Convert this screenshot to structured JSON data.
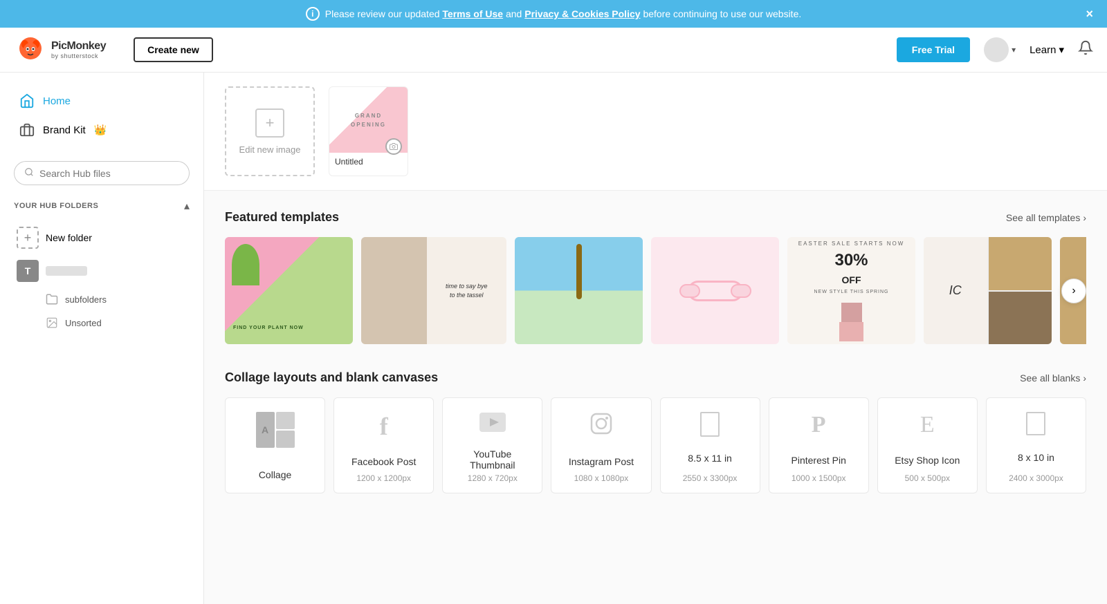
{
  "banner": {
    "text_before": "Please review our updated ",
    "terms_link": "Terms of Use",
    "text_middle": " and ",
    "privacy_link": "Privacy & Cookies Policy",
    "text_after": " before continuing to use our website.",
    "close_label": "×",
    "info_label": "i"
  },
  "header": {
    "logo_name": "PicMonkey",
    "logo_sub": "by shutterstock",
    "create_new_label": "Create new",
    "free_trial_label": "Free Trial",
    "learn_label": "Learn",
    "bell_label": "🔔"
  },
  "sidebar": {
    "nav_items": [
      {
        "id": "home",
        "label": "Home",
        "icon": "home"
      },
      {
        "id": "brand-kit",
        "label": "Brand Kit",
        "icon": "briefcase",
        "badge": "👑"
      }
    ],
    "search_placeholder": "Search Hub files",
    "hub_folders_title": "YOUR HUB FOLDERS",
    "folders": [
      {
        "id": "new-folder",
        "label": "New folder",
        "type": "new"
      },
      {
        "id": "t-folder",
        "label": "T",
        "type": "avatar"
      },
      {
        "id": "unsorted",
        "label": "Unsorted",
        "type": "unsorted"
      }
    ],
    "subfolder_label": "subfolders"
  },
  "recent": {
    "edit_new_label": "Edit new image",
    "files": [
      {
        "id": "untitled",
        "label": "Untitled",
        "type": "grand-opening"
      }
    ]
  },
  "featured_templates": {
    "title": "Featured templates",
    "see_all_label": "See all templates",
    "see_all_arrow": "›",
    "templates": [
      {
        "id": "tpl-1",
        "style": "plant"
      },
      {
        "id": "tpl-2",
        "style": "woman"
      },
      {
        "id": "tpl-3",
        "style": "palm"
      },
      {
        "id": "tpl-4",
        "style": "sunglasses"
      },
      {
        "id": "tpl-5",
        "style": "sale"
      },
      {
        "id": "tpl-6",
        "style": "fashion"
      },
      {
        "id": "tpl-7",
        "style": "collage"
      },
      {
        "id": "tpl-8",
        "style": "yellow"
      }
    ]
  },
  "collage_section": {
    "title": "Collage layouts and blank canvases",
    "see_all_label": "See all blanks",
    "see_all_arrow": "›",
    "blanks": [
      {
        "id": "collage",
        "label": "Collage",
        "size": "",
        "icon": "collage-grid"
      },
      {
        "id": "facebook-post",
        "label": "Facebook Post",
        "size": "1200 x 1200px",
        "icon": "facebook"
      },
      {
        "id": "youtube-thumbnail",
        "label": "YouTube Thumbnail",
        "size": "1280 x 720px",
        "icon": "youtube"
      },
      {
        "id": "instagram-post",
        "label": "Instagram Post",
        "size": "1080 x 1080px",
        "icon": "instagram"
      },
      {
        "id": "8-5x11",
        "label": "8.5 x 11 in",
        "size": "2550 x 3300px",
        "icon": "document"
      },
      {
        "id": "pinterest-pin",
        "label": "Pinterest Pin",
        "size": "1000 x 1500px",
        "icon": "pinterest"
      },
      {
        "id": "etsy-shop-icon",
        "label": "Etsy Shop Icon",
        "size": "500 x 500px",
        "icon": "etsy"
      },
      {
        "id": "8x10",
        "label": "8 x 10 in",
        "size": "2400 x 3000px",
        "icon": "document"
      }
    ]
  },
  "icons": {
    "facebook": "f",
    "youtube": "▶",
    "instagram": "◯",
    "pinterest": "P",
    "etsy": "E",
    "document": "▭",
    "search": "🔍",
    "chevron_down": "▾",
    "chevron_up": "▴"
  }
}
